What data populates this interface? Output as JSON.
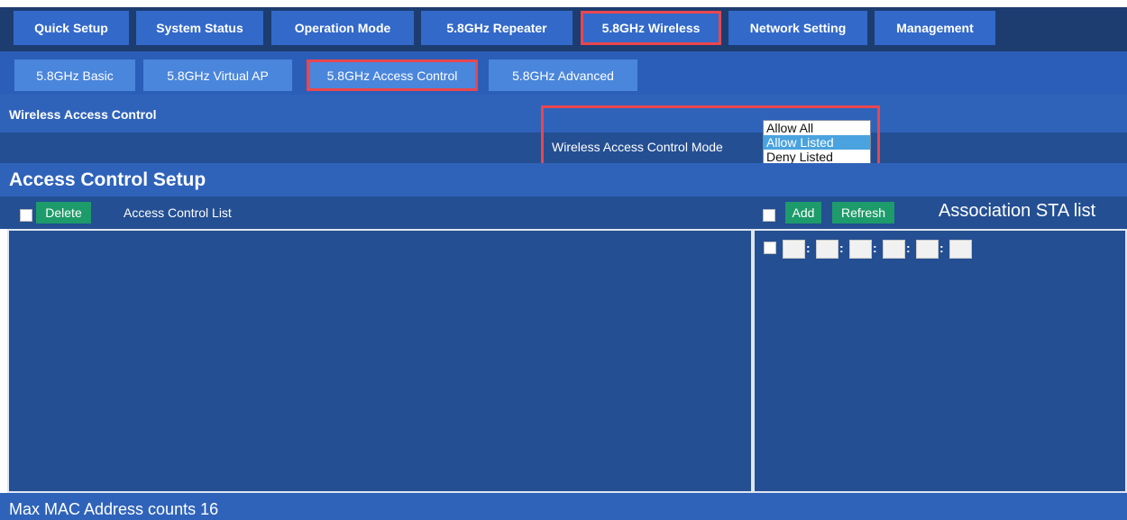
{
  "top_tabs": [
    "Quick Setup",
    "System Status",
    "Operation Mode",
    "5.8GHz Repeater",
    "5.8GHz Wireless",
    "Network Setting",
    "Management"
  ],
  "sub_tabs": [
    "5.8GHz Basic",
    "5.8GHz Virtual AP",
    "5.8GHz Access Control",
    "5.8GHz Advanced"
  ],
  "section_title": "Wireless Access Control",
  "mode": {
    "label": "Wireless Access Control Mode",
    "options": [
      "Allow All",
      "Allow Listed",
      "Deny Listed"
    ],
    "selected": "Allow Listed"
  },
  "setup": {
    "title": "Access Control Setup",
    "delete_label": "Delete",
    "list_label": "Access Control List",
    "add_label": "Add",
    "refresh_label": "Refresh",
    "sta_label": "Association STA list"
  },
  "footer_text": "Max MAC Address counts 16",
  "colors": {
    "highlight": "#e9464e",
    "panel": "#244f93",
    "tab": "#3369c9",
    "button": "#1d9b6a"
  }
}
